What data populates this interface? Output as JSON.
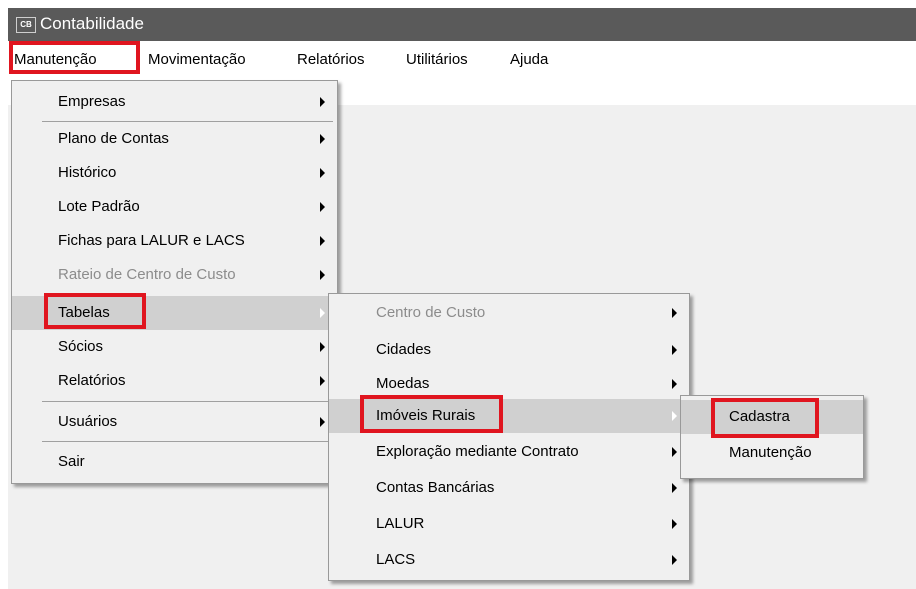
{
  "window": {
    "title": "Contabilidade",
    "icon_text": "CB"
  },
  "menubar": [
    "Manutenção",
    "Movimentação",
    "Relatórios",
    "Utilitários",
    "Ajuda"
  ],
  "manutencao_menu": [
    {
      "label": "Empresas",
      "submenu": true
    },
    {
      "label": "Plano de Contas",
      "submenu": true
    },
    {
      "label": "Histórico",
      "submenu": true
    },
    {
      "label": "Lote Padrão",
      "submenu": true
    },
    {
      "label": "Fichas para LALUR e LACS",
      "submenu": true
    },
    {
      "label": "Rateio de Centro de Custo",
      "submenu": true,
      "disabled": true
    },
    {
      "label": "Tabelas",
      "submenu": true,
      "selected": true
    },
    {
      "label": "Sócios",
      "submenu": true
    },
    {
      "label": "Relatórios",
      "submenu": true
    },
    {
      "label": "Usuários",
      "submenu": true
    },
    {
      "label": "Sair",
      "submenu": false
    }
  ],
  "tabelas_menu": [
    {
      "label": "Centro de Custo",
      "submenu": true,
      "disabled": true
    },
    {
      "label": "Cidades",
      "submenu": true
    },
    {
      "label": "Moedas",
      "submenu": true
    },
    {
      "label": "Imóveis Rurais",
      "submenu": true,
      "selected": true
    },
    {
      "label": "Exploração mediante Contrato",
      "submenu": true
    },
    {
      "label": "Contas Bancárias",
      "submenu": true
    },
    {
      "label": "LALUR",
      "submenu": true
    },
    {
      "label": "LACS",
      "submenu": true
    }
  ],
  "imoveis_menu": [
    {
      "label": "Cadastra",
      "selected": true
    },
    {
      "label": "Manutenção"
    }
  ],
  "colors": {
    "highlight": "#e0151f",
    "titlebar": "#5a5a5a",
    "menu_bg": "#f0f0f0",
    "selected_bg": "#d0d0d0"
  }
}
